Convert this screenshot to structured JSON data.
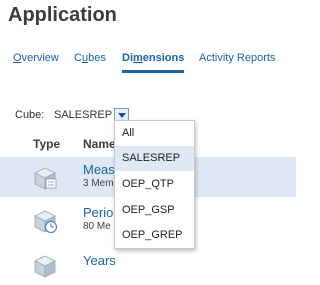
{
  "app": {
    "title": "Application"
  },
  "tabs": [
    {
      "mnemonic": "O",
      "rest": "verview",
      "label": "Overview"
    },
    {
      "mnemonic": "u",
      "label": "Cubes",
      "pre": "C",
      "post": "bes"
    },
    {
      "label": "Dimensions",
      "pre": "Di",
      "mnemonic": "m",
      "post": "ensions"
    },
    {
      "label": "Activity Reports"
    }
  ],
  "cube_selector": {
    "label": "Cube:",
    "value": "SALESREP"
  },
  "table": {
    "headers": [
      "Type",
      "Name"
    ],
    "rows": [
      {
        "name": "Meas",
        "sub": "3 Mem",
        "icon": "cube-dimension-icon",
        "selected": true
      },
      {
        "name": "Perio",
        "sub": "80 Me",
        "icon": "time-dimension-icon",
        "selected": false
      },
      {
        "name": "Years",
        "sub": "",
        "icon": "cube-dimension-icon",
        "selected": false
      }
    ]
  },
  "dropdown": {
    "options": [
      "All",
      "SALESREP",
      "OEP_QTP",
      "OEP_GSP",
      "OEP_GREP"
    ],
    "highlighted": "SALESREP"
  }
}
